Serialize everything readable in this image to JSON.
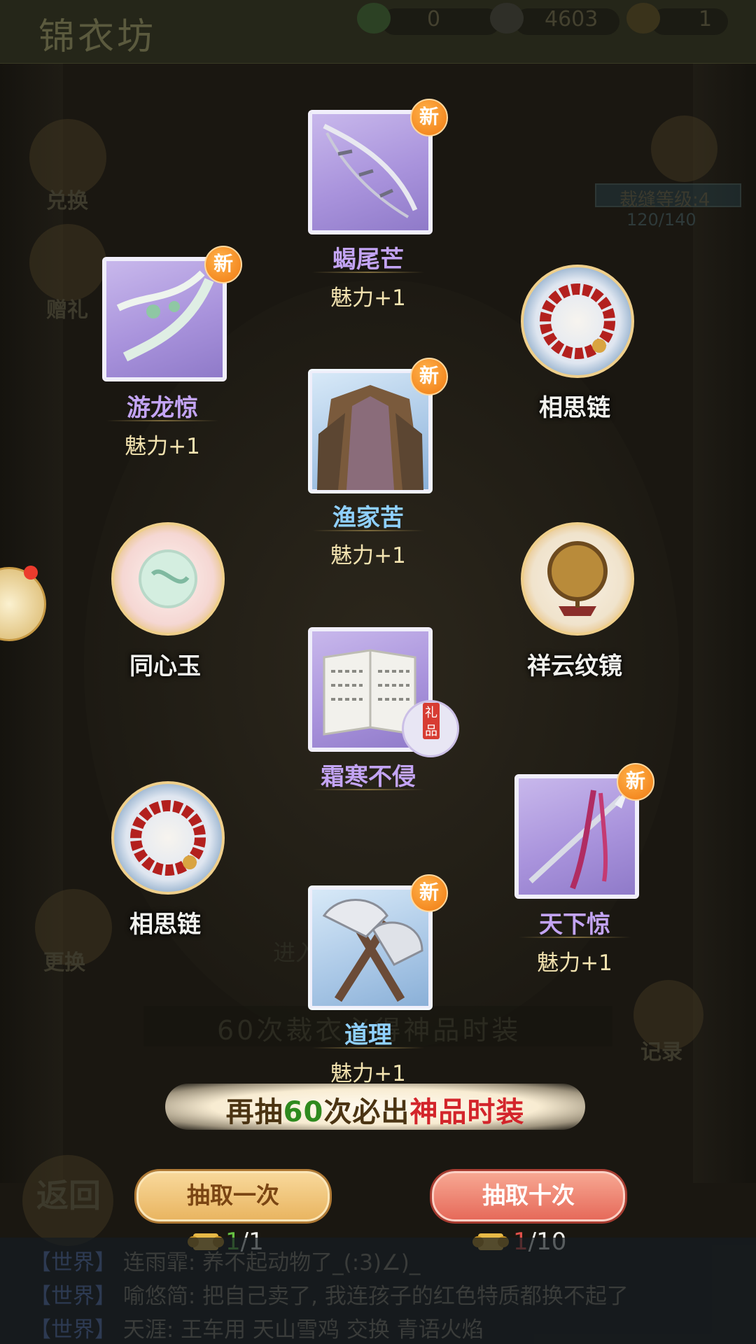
{
  "header": {
    "title": "锦衣坊",
    "resources": [
      {
        "icon": "jade-plus-icon",
        "value": "0"
      },
      {
        "icon": "silver-ingot-icon",
        "value": "4603"
      },
      {
        "icon": "gold-scroll-icon",
        "value": "1"
      }
    ]
  },
  "side_menu": {
    "exchange": "兑换",
    "gift": "赠礼",
    "swap": "更换",
    "record": "记录",
    "back": "返回"
  },
  "tailor": {
    "level_label": "裁缝等级:4",
    "progress": "120/140"
  },
  "background_text": {
    "hint": "60次裁衣必得神品时装",
    "enter": "进入"
  },
  "items": [
    {
      "name": "蝎尾芒",
      "charm": "魅力+1",
      "rarity": "purple",
      "new": "新",
      "icon": "scorpion-tail-weapon-icon"
    },
    {
      "name": "游龙惊",
      "charm": "魅力+1",
      "rarity": "purple",
      "new": "新",
      "icon": "dragon-ribbon-icon"
    },
    {
      "name": "相思链",
      "charm": "",
      "rarity": "white",
      "new": "",
      "icon": "red-bead-bracelet-icon"
    },
    {
      "name": "渔家苦",
      "charm": "魅力+1",
      "rarity": "blue",
      "new": "新",
      "icon": "fisher-cloak-outfit-icon"
    },
    {
      "name": "同心玉",
      "charm": "",
      "rarity": "white",
      "new": "",
      "icon": "jade-pendant-icon"
    },
    {
      "name": "祥云纹镜",
      "charm": "",
      "rarity": "white",
      "new": "",
      "icon": "bronze-mirror-icon"
    },
    {
      "name": "霜寒不侵",
      "charm": "",
      "rarity": "purple",
      "new": "",
      "gift_tag": "礼品",
      "icon": "pattern-book-icon"
    },
    {
      "name": "相思链",
      "charm": "",
      "rarity": "white",
      "new": "",
      "icon": "red-bead-bracelet-icon"
    },
    {
      "name": "天下惊",
      "charm": "魅力+1",
      "rarity": "purple",
      "new": "新",
      "icon": "spear-ribbon-icon"
    },
    {
      "name": "道理",
      "charm": "魅力+1",
      "rarity": "blue",
      "new": "新",
      "icon": "twin-axe-icon"
    }
  ],
  "banner": {
    "part1": "再抽",
    "part2": "60",
    "part3": "次必出",
    "part4": "神品时装"
  },
  "draw": {
    "one_label": "抽取一次",
    "one_have": "1",
    "one_need": "/1",
    "ten_label": "抽取十次",
    "ten_have": "1",
    "ten_need": "/10"
  },
  "chat": [
    {
      "channel": "【世界】",
      "text": "连雨霏: 养不起动物了_(:3)∠)_"
    },
    {
      "channel": "【世界】",
      "text": "喻悠简: 把自己卖了, 我连孩子的红色特质都换不起了"
    },
    {
      "channel": "【世界】",
      "text": "天涯: 王车用 天山雪鸡 交换 青语火焰"
    }
  ],
  "colors": {
    "purple_name": "#c3a4f4",
    "blue_name": "#8fd0ff",
    "charm": "#f3e3b0",
    "new_badge": "#f07a12",
    "banner_red": "#d3252b",
    "banner_green": "#2f8a1f"
  }
}
